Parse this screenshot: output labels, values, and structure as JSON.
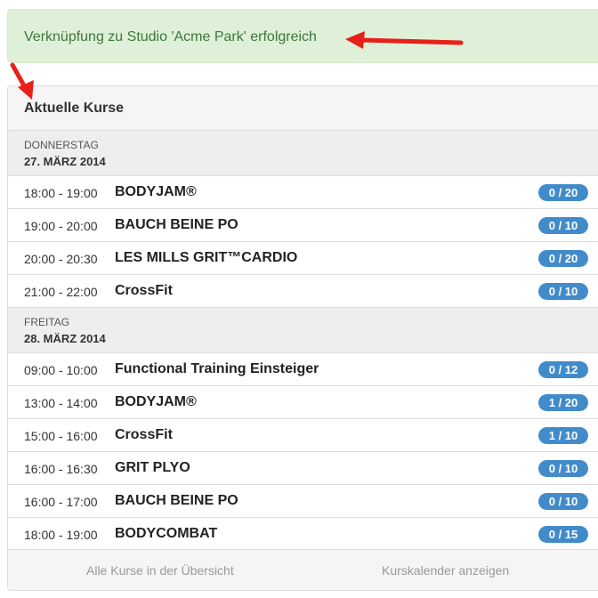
{
  "alert": {
    "message": "Verknüpfung zu Studio 'Acme Park' erfolgreich"
  },
  "panel": {
    "title": "Aktuelle Kurse",
    "days": [
      {
        "weekday": "DONNERSTAG",
        "date": "27. MÄRZ 2014",
        "courses": [
          {
            "time": "18:00 - 19:00",
            "name": "BODYJAM®",
            "spots": "0 / 20"
          },
          {
            "time": "19:00 - 20:00",
            "name": "BAUCH BEINE PO",
            "spots": "0 / 10"
          },
          {
            "time": "20:00 - 20:30",
            "name": "LES MILLS GRIT™CARDIO",
            "spots": "0 / 20"
          },
          {
            "time": "21:00 - 22:00",
            "name": "CrossFit",
            "spots": "0 / 10"
          }
        ]
      },
      {
        "weekday": "FREITAG",
        "date": "28. MÄRZ 2014",
        "courses": [
          {
            "time": "09:00 - 10:00",
            "name": "Functional Training Einsteiger",
            "spots": "0 / 12"
          },
          {
            "time": "13:00 - 14:00",
            "name": "BODYJAM®",
            "spots": "1 / 20"
          },
          {
            "time": "15:00 - 16:00",
            "name": "CrossFit",
            "spots": "1 / 10"
          },
          {
            "time": "16:00 - 16:30",
            "name": "GRIT PLYO",
            "spots": "0 / 10"
          },
          {
            "time": "16:00 - 17:00",
            "name": "BAUCH BEINE PO",
            "spots": "0 / 10"
          },
          {
            "time": "18:00 - 19:00",
            "name": "BODYCOMBAT",
            "spots": "0 / 15"
          }
        ]
      }
    ],
    "footer": {
      "overview_link": "Alle Kurse in der Übersicht",
      "calendar_link": "Kurskalender anzeigen"
    }
  },
  "colors": {
    "alert_bg": "#dff0d8",
    "alert_text": "#3c763d",
    "badge": "#428bca",
    "annotation_arrow": "#e8201a"
  }
}
